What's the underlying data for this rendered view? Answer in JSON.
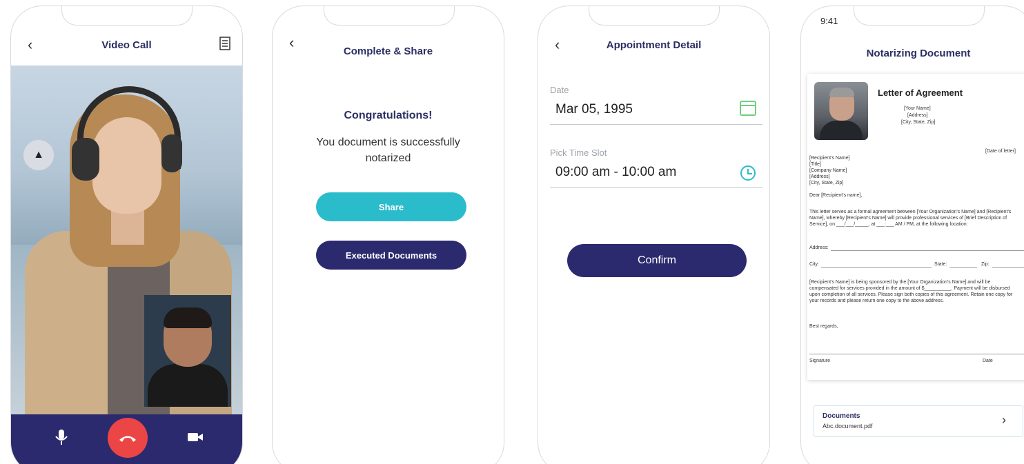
{
  "screens": {
    "video_call": {
      "title": "Video Call",
      "back_icon": "chevron-left-icon",
      "document_icon": "document-icon",
      "controls": [
        "mic-icon",
        "end-call-icon",
        "video-camera-icon"
      ],
      "colors": {
        "bar": "#2c2a6e",
        "end_call": "#ec4546"
      }
    },
    "complete_share": {
      "title": "Complete & Share",
      "heading": "Congratulations!",
      "message": "You document is successfully notarized",
      "share_label": "Share",
      "executed_label": "Executed Documents",
      "colors": {
        "share": "#2bbccc",
        "executed": "#2c2a6e"
      }
    },
    "appointment": {
      "title": "Appointment Detail",
      "date_label": "Date",
      "date_value": "Mar 05, 1995",
      "time_label": "Pick Time Slot",
      "time_value": "09:00 am - 10:00 am",
      "confirm_label": "Confirm"
    },
    "notarizing": {
      "status_time": "9:41",
      "title": "Notarizing Document",
      "letter": {
        "title": "Letter of Agreement",
        "sender_lines": [
          "[Your Name]",
          "[Address]",
          "[City, State, Zip]"
        ],
        "date": "[Date of letter]",
        "recipient_lines": [
          "[Recipient's Name]",
          "[Title]",
          "[Company Name]",
          "[Address]",
          "[City, State, Zip]"
        ],
        "salutation": "Dear [Recipient's name],",
        "paragraph1": "This letter serves as a formal agreement between [Your Organization's Name] and [Recipient's Name], whereby [Recipient's Name] will provide professional services of [Brief Description of Service], on ___/___/_____, at ___:___ AM / PM, at the following location:",
        "address_label": "Address:",
        "city_label": "City:",
        "state_label": "State:",
        "zip_label": "Zip:",
        "paragraph2": "[Recipient's Name] is being sponsored by the [Your Organization's Name] and will be compensated for services provided in the amount of $__________. Payment will be disbursed upon completion of all services. Please sign both copies of this agreement. Retain one copy for your records and please return one copy to the above address.",
        "closing": "Best regards,",
        "signature_label": "Signature",
        "date_label": "Date"
      },
      "documents_title": "Documents",
      "documents_file": "Abc.document.pdf"
    }
  }
}
